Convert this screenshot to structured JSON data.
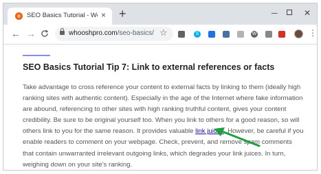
{
  "browser": {
    "tab_title": "SEO Basics Tutorial - Website Se",
    "tab_close": "×",
    "new_tab": "+",
    "window_controls": {
      "minimize": "─",
      "close": "✕"
    },
    "nav": {
      "back": "←",
      "forward": "→",
      "reload": "C"
    },
    "url_host": "whooshpro.com",
    "url_path": "/seo-basics/",
    "bookmark_star": "☆",
    "menu": "⋮",
    "extensions": [
      "camera-icon",
      "skype-icon",
      "blue-extension-icon",
      "grid-extension-icon",
      "pdf-extension-icon",
      "wordpress-icon",
      "box-extension-icon",
      "red-extension-icon"
    ]
  },
  "article": {
    "heading": "SEO Basics Tutorial Tip 7: Link to external references or facts",
    "paragraph_before": "Take advantage to cross reference your content to external facts by linking to them (ideally high ranking sites with authentic content). Especially in the age of the Internet where fake information are abound, referencing to other sites with high ranking truthful content, gives your content credibility. Be sure to be original yourself too. When you link to others for a good reason, so will others link to you for the same reason. It provides valuable ",
    "link_text": "link juices",
    "paragraph_after": ". However, be careful if you enable readers to comment on your webpage. Check, prevent, and remove spam comments that contain unwarranted irrelevant outgoing links, which degrades your link juices. In turn, weighing down on your site's ranking."
  },
  "colors": {
    "accent_line": "#8a8ae6",
    "link": "#1a0dab",
    "arrow": "#1e9e3f"
  }
}
